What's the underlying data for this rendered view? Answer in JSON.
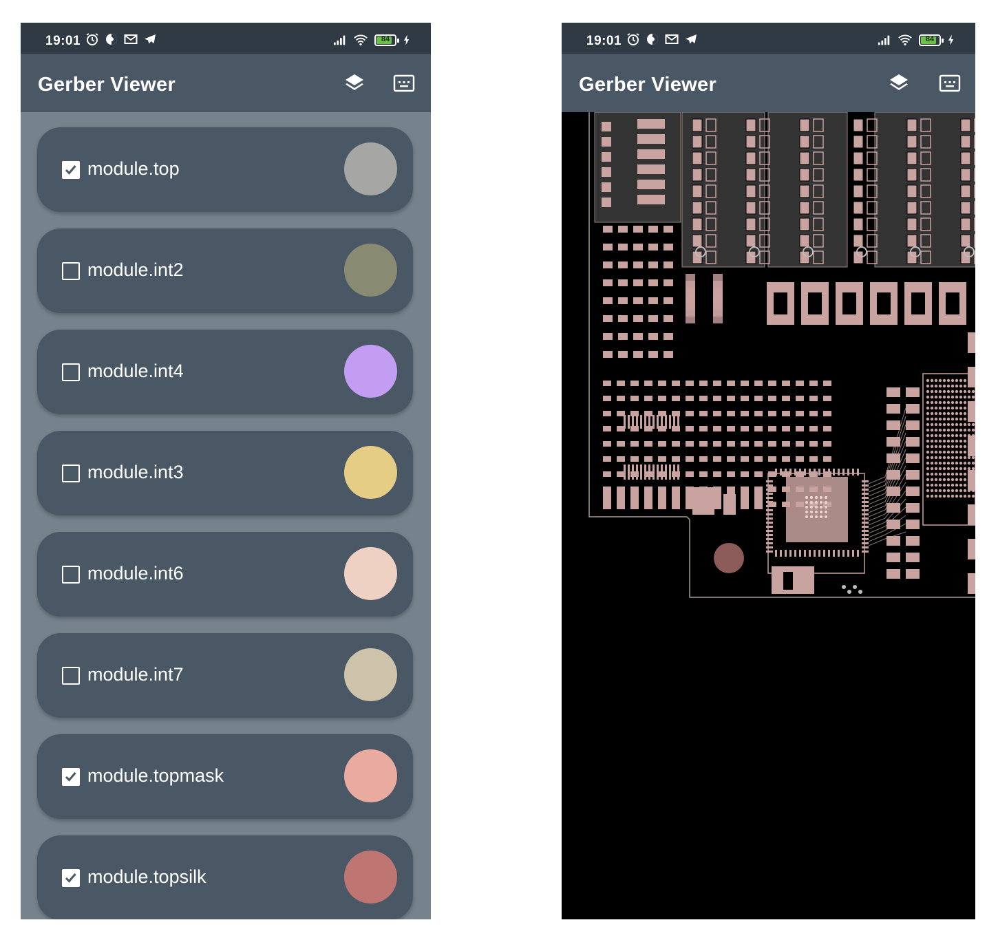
{
  "status": {
    "time": "19:01",
    "battery": "84"
  },
  "app": {
    "title": "Gerber Viewer"
  },
  "layers": [
    {
      "name": "module.top",
      "checked": true,
      "color": "#a6a7a4"
    },
    {
      "name": "module.int2",
      "checked": false,
      "color": "#888a72"
    },
    {
      "name": "module.int4",
      "checked": false,
      "color": "#c39df2"
    },
    {
      "name": "module.int3",
      "checked": false,
      "color": "#e5cd86"
    },
    {
      "name": "module.int6",
      "checked": false,
      "color": "#efd1c4"
    },
    {
      "name": "module.int7",
      "checked": false,
      "color": "#cdc3ab"
    },
    {
      "name": "module.topmask",
      "checked": true,
      "color": "#e9aa9f"
    },
    {
      "name": "module.topsilk",
      "checked": true,
      "color": "#bf7672"
    }
  ],
  "viewer": {
    "background": "#000000",
    "copper_color": "#c9a3a0",
    "outline_color": "#a89a98"
  }
}
